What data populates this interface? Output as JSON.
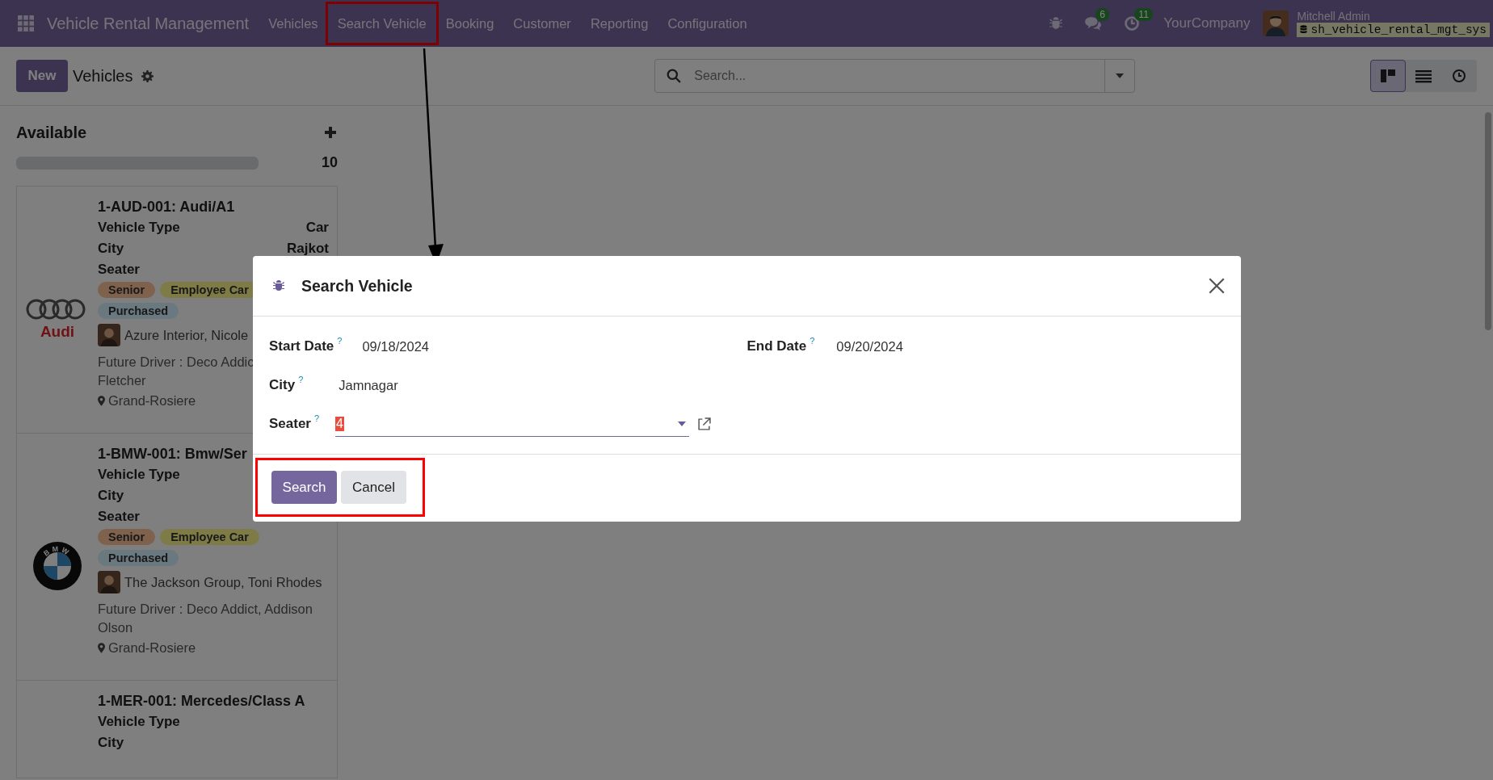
{
  "navbar": {
    "app_name": "Vehicle Rental Management",
    "menus": [
      {
        "label": "Vehicles",
        "highlighted": false
      },
      {
        "label": "Search Vehicle",
        "highlighted": true
      },
      {
        "label": "Booking",
        "highlighted": false
      },
      {
        "label": "Customer",
        "highlighted": false
      },
      {
        "label": "Reporting",
        "highlighted": false
      },
      {
        "label": "Configuration",
        "highlighted": false
      }
    ],
    "messages_count": "6",
    "activities_count": "11",
    "company": "YourCompany",
    "user": "Mitchell Admin",
    "database": "sh_vehicle_rental_mgt_sys"
  },
  "control_panel": {
    "new_button": "New",
    "title": "Vehicles",
    "search": {
      "placeholder": "Search..."
    },
    "views": [
      {
        "kind": "kanban",
        "selected": true
      },
      {
        "kind": "list",
        "selected": false
      },
      {
        "kind": "activity",
        "selected": false
      }
    ]
  },
  "column": {
    "title": "Available",
    "count": "10",
    "level": 0,
    "cards": [
      {
        "logo": {
          "kind": "rings",
          "text": "Audi"
        },
        "title": "1-AUD-001: Audi/A1",
        "fields": [
          {
            "label": "Vehicle Type",
            "value": "Car"
          },
          {
            "label": "City",
            "value": "Rajkot"
          },
          {
            "label": "Seater"
          }
        ],
        "tags": [
          {
            "label": "Senior",
            "color": "#86624e"
          },
          {
            "label": "Employee Car",
            "color": "#857b46"
          },
          {
            "label": "Purchased",
            "color": "#6a787f"
          }
        ],
        "customer": "Azure Interior, Nicole",
        "future_driver": [
          "Future Driver : Deco Addic",
          "Fletcher"
        ],
        "location": "Grand-Rosiere"
      },
      {
        "logo": {
          "kind": "roundel",
          "text": "BMW"
        },
        "title": "1-BMW-001: Bmw/Ser",
        "fields": [
          {
            "label": "Vehicle Type"
          },
          {
            "label": "City"
          },
          {
            "label": "Seater"
          }
        ],
        "tags": [
          {
            "label": "Senior",
            "color": "#86624e"
          },
          {
            "label": "Employee Car",
            "color": "#857b46"
          },
          {
            "label": "Purchased",
            "color": "#6a787f"
          }
        ],
        "customer": "The Jackson Group, Toni Rhodes",
        "future_driver": [
          "Future Driver : Deco Addict, Addison",
          "Olson"
        ],
        "location": "Grand-Rosiere"
      },
      {
        "title": "1-MER-001: Mercedes/Class A",
        "fields": [
          {
            "label": "Vehicle Type"
          },
          {
            "label": "City"
          }
        ]
      }
    ]
  },
  "dialog": {
    "title": "Search Vehicle",
    "start_date": {
      "label": "Start Date",
      "value": "09/18/2024"
    },
    "end_date": {
      "label": "End Date",
      "value": "09/20/2024"
    },
    "city": {
      "label": "City",
      "value": "Jamnagar"
    },
    "seater": {
      "label": "Seater",
      "value": "4"
    },
    "help_mark": "?",
    "buttons": [
      {
        "label": "Search",
        "kind": "primary"
      },
      {
        "label": "Cancel",
        "kind": "secondary"
      }
    ],
    "footer_highlighted": true
  }
}
